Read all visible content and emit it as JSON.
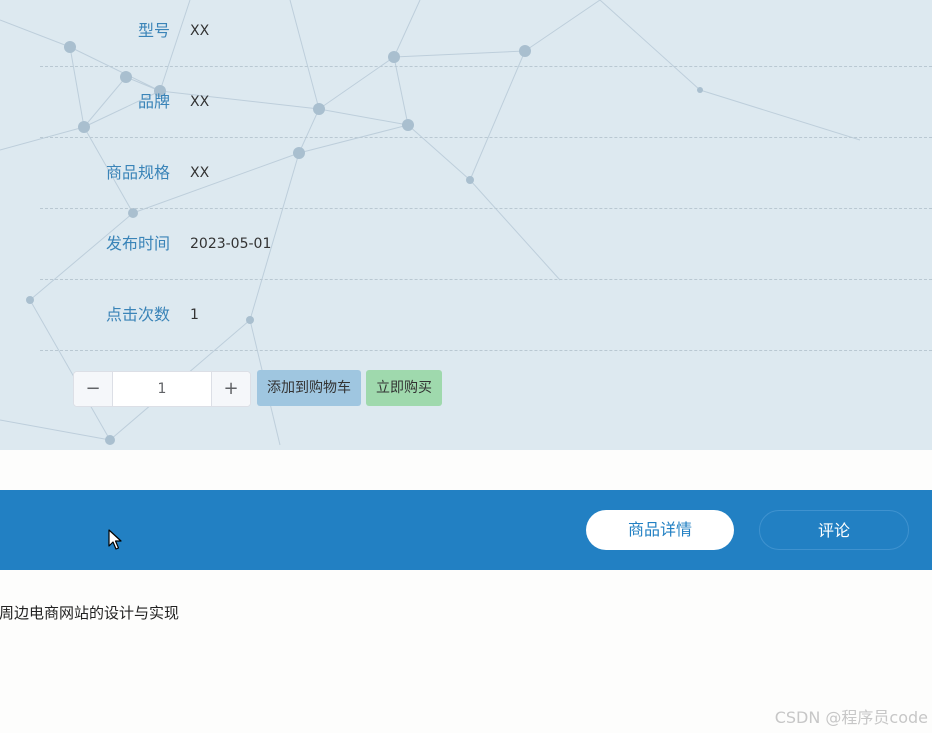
{
  "specs": [
    {
      "label": "型号",
      "value": "XX"
    },
    {
      "label": "品牌",
      "value": "XX"
    },
    {
      "label": "商品规格",
      "value": "XX"
    },
    {
      "label": "发布时间",
      "value": "2023-05-01"
    },
    {
      "label": "点击次数",
      "value": "1"
    }
  ],
  "quantity": {
    "minus": "−",
    "plus": "+",
    "value": "1"
  },
  "actions": {
    "add_to_cart": "添加到购物车",
    "buy_now": "立即购买"
  },
  "tabs": [
    {
      "label": "商品详情",
      "active": true
    },
    {
      "label": "评论",
      "active": false
    }
  ],
  "content": {
    "description": "周边电商网站的设计与实现"
  },
  "watermark": "CSDN @程序员code",
  "colors": {
    "panel_bg": "#dde9f0",
    "label": "#3a84b8",
    "tab_bar": "#2280c3",
    "cart_button": "#9fc6e0",
    "buy_button": "#9fd9ad"
  },
  "icons": {
    "cursor": "arrow-cursor-icon"
  }
}
